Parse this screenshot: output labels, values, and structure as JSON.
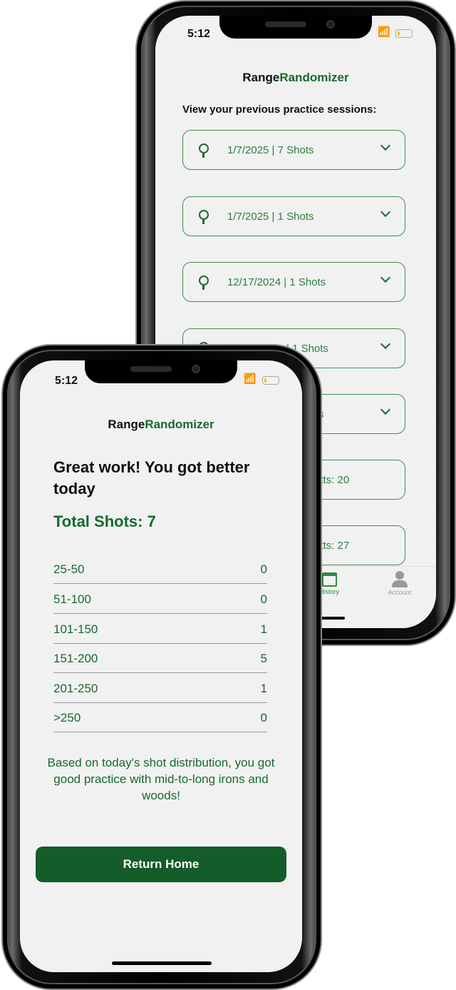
{
  "history_screen": {
    "status": {
      "time": "5:12"
    },
    "brand": {
      "part1": "Range",
      "part2": "Randomizer"
    },
    "prompt": "View your previous practice sessions:",
    "sessions": [
      {
        "label": "1/7/2025 | 7 Shots"
      },
      {
        "label": "1/7/2025 | 1 Shots"
      },
      {
        "label": "12/17/2024 | 1 Shots"
      },
      {
        "label": "| 1 Shots"
      },
      {
        "label": "s"
      },
      {
        "label": "utts: 20"
      },
      {
        "label": "utts: 27"
      }
    ],
    "tabbar": {
      "history": "History",
      "account": "Account"
    },
    "colors": {
      "accent": "#17692f"
    }
  },
  "summary_screen": {
    "status": {
      "time": "5:12"
    },
    "brand": {
      "part1": "Range",
      "part2": "Randomizer"
    },
    "heading": "Great work!  You got better today",
    "total": "Total Shots: 7",
    "distribution": [
      {
        "range": "25-50",
        "count": "0"
      },
      {
        "range": "51-100",
        "count": "0"
      },
      {
        "range": "101-150",
        "count": "1"
      },
      {
        "range": "151-200",
        "count": "5"
      },
      {
        "range": "201-250",
        "count": "1"
      },
      {
        "range": ">250",
        "count": "0"
      }
    ],
    "message": "Based on today's shot distribution, you got good practice with mid-to-long irons and woods!",
    "return_button": "Return Home",
    "colors": {
      "button": "#145c2a"
    }
  }
}
